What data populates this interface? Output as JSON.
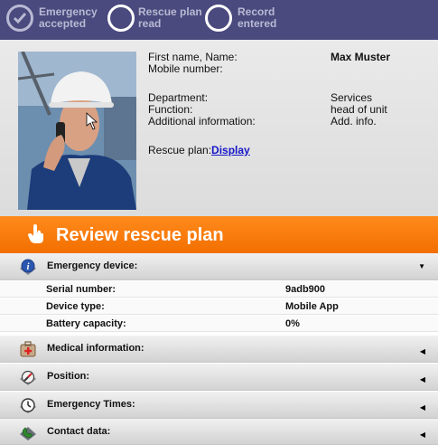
{
  "steps": [
    {
      "label_line1": "Emergency",
      "label_line2": "accepted",
      "state": "done"
    },
    {
      "label_line1": "Rescue plan",
      "label_line2": "read",
      "state": "open"
    },
    {
      "label_line1": "Record",
      "label_line2": "entered",
      "state": "open"
    }
  ],
  "person": {
    "labels": {
      "name": "First name, Name:",
      "mobile": "Mobile number:",
      "department": "Department:",
      "function": "Function:",
      "additional": "Additional information:",
      "rescue_plan": "Rescue plan:"
    },
    "values": {
      "name": "Max Muster",
      "department": "Services",
      "function": "head of unit",
      "additional": "Add. info."
    },
    "rescue_plan_link": "Display"
  },
  "banner": {
    "title": "Review rescue plan"
  },
  "sections": {
    "emergency_device": {
      "title": "Emergency device:",
      "rows": [
        {
          "label": "Serial number:",
          "value": "9adb900"
        },
        {
          "label": "Device type:",
          "value": "Mobile App"
        },
        {
          "label": "Battery capacity:",
          "value": "0%"
        }
      ]
    },
    "medical": {
      "title": "Medical information:"
    },
    "position": {
      "title": "Position:"
    },
    "times": {
      "title": "Emergency Times:"
    },
    "contact": {
      "title": "Contact data:"
    }
  },
  "colors": {
    "status_bar": "#4a4a7e",
    "banner": "#f57a0a",
    "link": "#1616c8"
  }
}
